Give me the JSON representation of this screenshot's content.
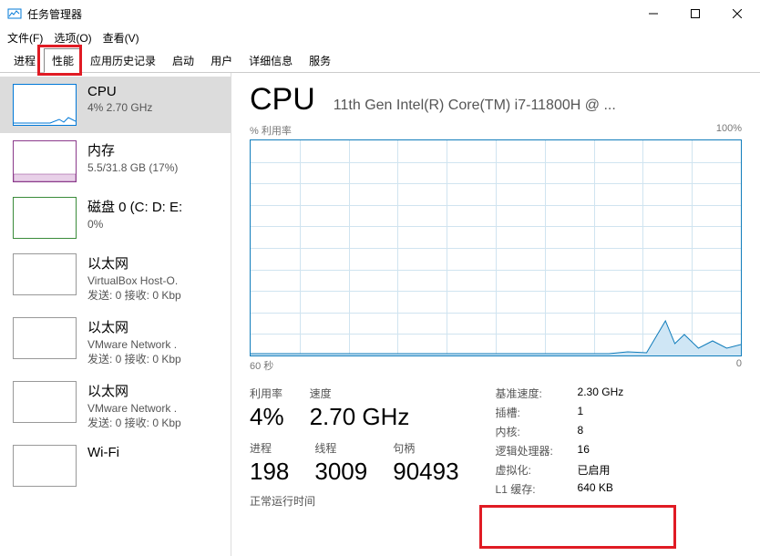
{
  "window": {
    "title": "任务管理器"
  },
  "menu": {
    "file": "文件(F)",
    "options": "选项(O)",
    "view": "查看(V)"
  },
  "tabs": {
    "processes": "进程",
    "performance": "性能",
    "history": "应用历史记录",
    "startup": "启动",
    "users": "用户",
    "details": "详细信息",
    "services": "服务"
  },
  "sidebar": [
    {
      "title": "CPU",
      "sub": "4%  2.70 GHz",
      "type": "cpu"
    },
    {
      "title": "内存",
      "sub": "5.5/31.8 GB (17%)",
      "type": "memory"
    },
    {
      "title": "磁盘 0 (C: D: E:",
      "sub": "0%",
      "type": "disk"
    },
    {
      "title": "以太网",
      "sub": "VirtualBox Host-O.",
      "sub2": "发送: 0 接收: 0 Kbp",
      "type": "net"
    },
    {
      "title": "以太网",
      "sub": "VMware Network .",
      "sub2": "发送: 0 接收: 0 Kbp",
      "type": "net"
    },
    {
      "title": "以太网",
      "sub": "VMware Network .",
      "sub2": "发送: 0 接收: 0 Kbp",
      "type": "net"
    },
    {
      "title": "Wi-Fi",
      "sub": "",
      "type": "net"
    }
  ],
  "main": {
    "heading": "CPU",
    "cpu_name": "11th Gen Intel(R) Core(TM) i7-11800H @ ...",
    "util_label": "% 利用率",
    "util_max": "100%",
    "x_left": "60 秒",
    "x_right": "0",
    "stats_left": [
      {
        "lbl": "利用率",
        "val": "4%"
      },
      {
        "lbl": "速度",
        "val": "2.70 GHz"
      }
    ],
    "stats_left2": [
      {
        "lbl": "进程",
        "val": "198"
      },
      {
        "lbl": "线程",
        "val": "3009"
      },
      {
        "lbl": "句柄",
        "val": "90493"
      }
    ],
    "stats_right": [
      {
        "k": "基准速度:",
        "v": "2.30 GHz"
      },
      {
        "k": "插槽:",
        "v": "1"
      },
      {
        "k": "内核:",
        "v": "8"
      },
      {
        "k": "逻辑处理器:",
        "v": "16"
      },
      {
        "k": "虚拟化:",
        "v": "已启用"
      },
      {
        "k": "L1 缓存:",
        "v": "640 KB"
      }
    ],
    "uptime_lbl": "正常运行时间"
  }
}
